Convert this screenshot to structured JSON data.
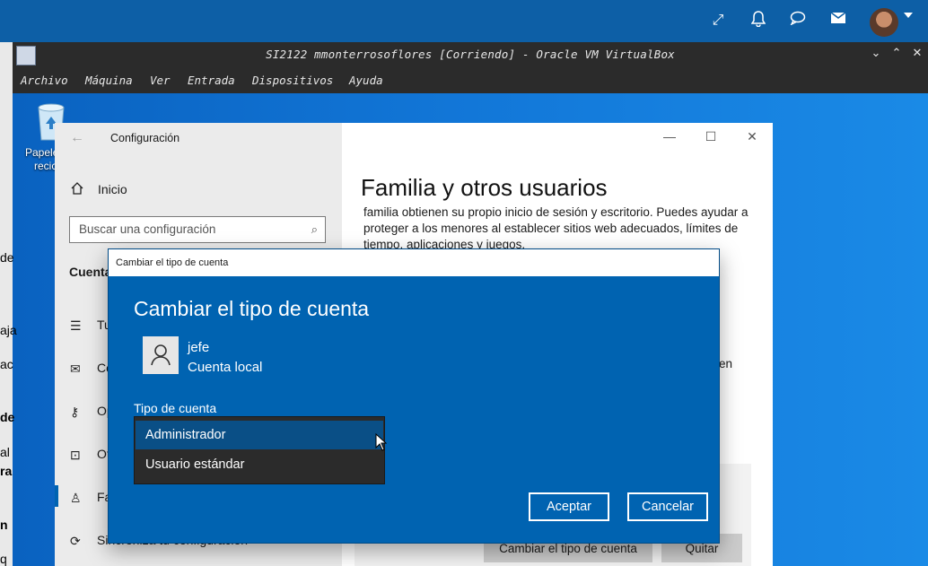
{
  "host": {
    "icons": [
      "fullscreen-icon",
      "bell-icon",
      "chat-icon",
      "mail-icon",
      "avatar",
      "chevron-down-icon"
    ]
  },
  "vbox": {
    "title": "SI2122 mmonterrosoflores [Corriendo] - Oracle VM VirtualBox",
    "menu": [
      "Archivo",
      "Máquina",
      "Ver",
      "Entrada",
      "Dispositivos",
      "Ayuda"
    ]
  },
  "desktop": {
    "recycle_label_1": "Papele",
    "recycle_label_2": "recic",
    "left_fragments": [
      "de",
      "aja",
      "ac",
      "de",
      "al",
      "ra",
      "n",
      "q"
    ]
  },
  "settings": {
    "window_title": "Configuración",
    "home": "Inicio",
    "search_placeholder": "Buscar una configuración",
    "section": "Cuenta",
    "side_items": [
      "Tu",
      "Co",
      "Op",
      "Ot",
      "Fa",
      "Sincroniza tu configuración"
    ],
    "page_title": "Familia y otros usuarios",
    "description": "familia obtienen su propio inicio de sesión y escritorio. Puedes ayudar a proteger a los menores al establecer sitios web adecuados, límites de tiempo, aplicaciones y juegos.",
    "fragment": "en",
    "btn_change_type": "Cambiar el tipo de cuenta",
    "btn_remove": "Quitar"
  },
  "dialog": {
    "titlebar": "Cambiar el tipo de cuenta",
    "heading": "Cambiar el tipo de cuenta",
    "user_name": "jefe",
    "user_type": "Cuenta local",
    "type_label": "Tipo de cuenta",
    "options": [
      "Administrador",
      "Usuario estándar"
    ],
    "selected": "Administrador",
    "ok": "Aceptar",
    "cancel": "Cancelar"
  },
  "colors": {
    "dialog_bg": "#0063b1",
    "dropdown_bg": "#2b2b2b",
    "selected_option": "#0a4f86",
    "vbox_chrome": "#2b2b2b"
  }
}
